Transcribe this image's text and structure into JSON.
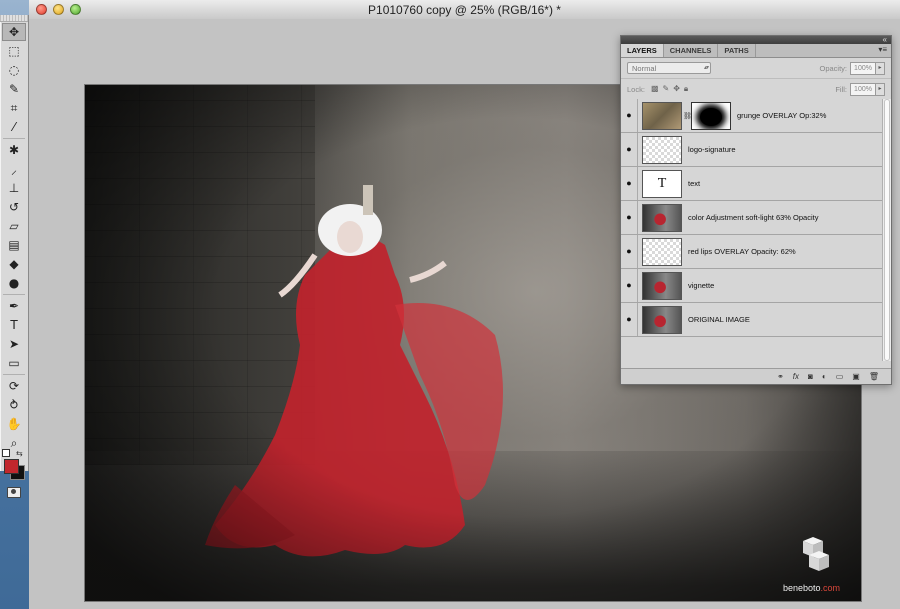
{
  "window": {
    "title": "P1010760 copy @ 25% (RGB/16*) *"
  },
  "tools": {
    "items": [
      "move",
      "marquee",
      "lasso",
      "quick-select",
      "crop",
      "eyedropper",
      "healing",
      "brush",
      "stamp",
      "history-brush",
      "eraser",
      "gradient",
      "blur",
      "dodge",
      "pen",
      "type",
      "path-select",
      "shape",
      "3d-rotate",
      "3d-orbit",
      "hand",
      "zoom"
    ],
    "foreground_color": "#c2272d",
    "background_color": "#111111"
  },
  "layers_panel": {
    "tabs": [
      "LAYERS",
      "CHANNELS",
      "PATHS"
    ],
    "active_tab": "LAYERS",
    "blend_mode": "Normal",
    "opacity_label": "Opacity:",
    "opacity_value": "100%",
    "lock_label": "Lock:",
    "fill_label": "Fill:",
    "fill_value": "100%",
    "layers": [
      {
        "name": "grunge OVERLAY Op:32%",
        "thumb": "grunge",
        "has_mask": true,
        "visible": true
      },
      {
        "name": "logo-signature",
        "thumb": "checker",
        "has_mask": false,
        "visible": true
      },
      {
        "name": "text",
        "thumb": "text",
        "has_mask": false,
        "visible": true
      },
      {
        "name": "color Adjustment soft-light 63% Opacity",
        "thumb": "photo",
        "has_mask": false,
        "visible": true
      },
      {
        "name": "red lips OVERLAY Opacity: 62%",
        "thumb": "checker",
        "has_mask": false,
        "visible": true
      },
      {
        "name": "vignette",
        "thumb": "photo",
        "has_mask": false,
        "visible": true
      },
      {
        "name": "ORIGINAL IMAGE",
        "thumb": "photo",
        "has_mask": false,
        "visible": true
      }
    ],
    "text_thumb_glyph": "T",
    "bottom_icons": [
      "link-layers-icon",
      "fx-icon",
      "add-mask-icon",
      "adjustment-layer-icon",
      "group-icon",
      "new-layer-icon",
      "trash-icon"
    ]
  },
  "photo_logo": {
    "brand": "beneboto",
    "suffix": ".com"
  }
}
